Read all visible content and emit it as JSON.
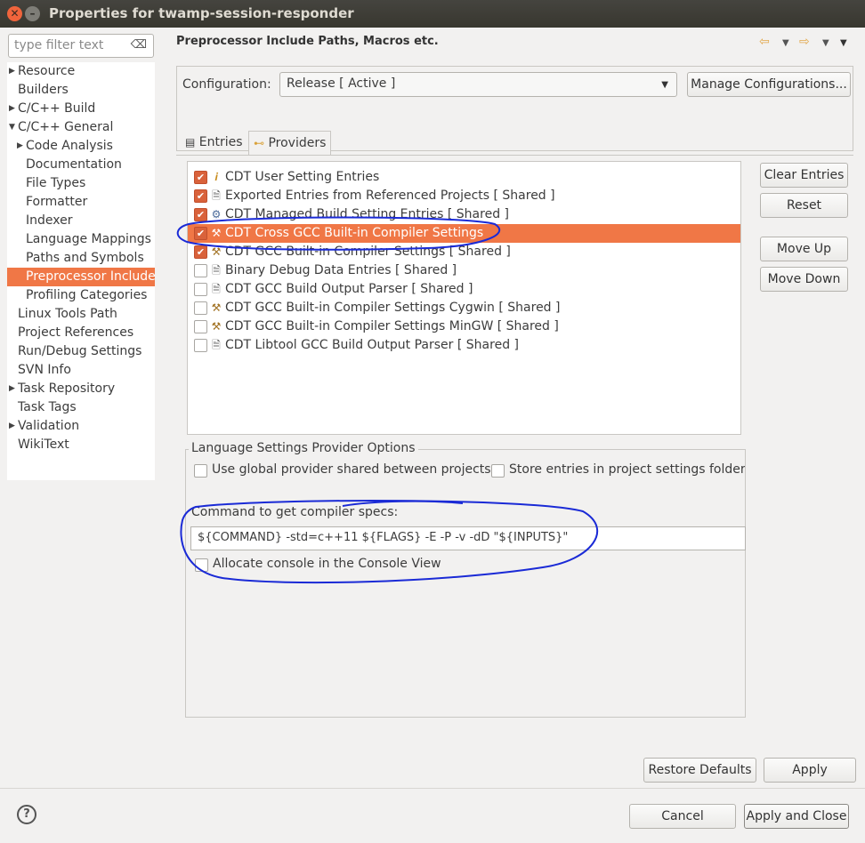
{
  "window": {
    "title": "Properties for twamp-session-responder"
  },
  "filter": {
    "placeholder": "type filter text"
  },
  "tree": [
    {
      "label": "Resource",
      "arrow": true,
      "indent": 0
    },
    {
      "label": "Builders",
      "arrow": false,
      "indent": 0
    },
    {
      "label": "C/C++ Build",
      "arrow": true,
      "indent": 0
    },
    {
      "label": "C/C++ General",
      "arrow": "open",
      "indent": 0
    },
    {
      "label": "Code Analysis",
      "arrow": true,
      "indent": 1
    },
    {
      "label": "Documentation",
      "arrow": false,
      "indent": 1
    },
    {
      "label": "File Types",
      "arrow": false,
      "indent": 1
    },
    {
      "label": "Formatter",
      "arrow": false,
      "indent": 1
    },
    {
      "label": "Indexer",
      "arrow": false,
      "indent": 1
    },
    {
      "label": "Language Mappings",
      "arrow": false,
      "indent": 1
    },
    {
      "label": "Paths and Symbols",
      "arrow": false,
      "indent": 1
    },
    {
      "label": "Preprocessor Include",
      "arrow": false,
      "indent": 1,
      "selected": true
    },
    {
      "label": "Profiling Categories",
      "arrow": false,
      "indent": 1
    },
    {
      "label": "Linux Tools Path",
      "arrow": false,
      "indent": 0
    },
    {
      "label": "Project References",
      "arrow": false,
      "indent": 0
    },
    {
      "label": "Run/Debug Settings",
      "arrow": false,
      "indent": 0
    },
    {
      "label": "SVN Info",
      "arrow": false,
      "indent": 0
    },
    {
      "label": "Task Repository",
      "arrow": true,
      "indent": 0
    },
    {
      "label": "Task Tags",
      "arrow": false,
      "indent": 0
    },
    {
      "label": "Validation",
      "arrow": true,
      "indent": 0
    },
    {
      "label": "WikiText",
      "arrow": false,
      "indent": 0
    }
  ],
  "page": {
    "title": "Preprocessor Include Paths, Macros etc."
  },
  "config": {
    "label": "Configuration:",
    "value": "Release  [ Active ]",
    "manage_label": "Manage Configurations..."
  },
  "tabs": {
    "entries": "Entries",
    "providers": "Providers"
  },
  "providers": [
    {
      "label": "CDT User Setting Entries",
      "checked": true,
      "icon": "user-setting-icon"
    },
    {
      "label": "Exported Entries from Referenced Projects  [ Shared ]",
      "checked": true,
      "icon": "exported-entries-icon"
    },
    {
      "label": "CDT Managed Build Setting Entries  [ Shared ]",
      "checked": true,
      "icon": "managed-build-icon"
    },
    {
      "label": "CDT Cross GCC Built-in Compiler Settings",
      "checked": true,
      "icon": "compiler-icon",
      "selected": true
    },
    {
      "label": "CDT GCC Built-in Compiler Settings  [ Shared ]",
      "checked": true,
      "icon": "compiler-icon"
    },
    {
      "label": "Binary Debug Data Entries  [ Shared ]",
      "checked": false,
      "icon": "document-icon"
    },
    {
      "label": "CDT GCC Build Output Parser  [ Shared ]",
      "checked": false,
      "icon": "document-icon"
    },
    {
      "label": "CDT GCC Built-in Compiler Settings Cygwin  [ Shared ]",
      "checked": false,
      "icon": "compiler-icon"
    },
    {
      "label": "CDT GCC Built-in Compiler Settings MinGW  [ Shared ]",
      "checked": false,
      "icon": "compiler-icon"
    },
    {
      "label": "CDT Libtool GCC Build Output Parser  [ Shared ]",
      "checked": false,
      "icon": "document-icon"
    }
  ],
  "side_buttons": {
    "clear": "Clear Entries",
    "reset": "Reset",
    "move_up": "Move Up",
    "move_down": "Move Down"
  },
  "options": {
    "title": "Language Settings Provider Options",
    "global_label": "Use global provider shared between projects",
    "store_label": "Store entries in project settings folder (",
    "command_label": "Command to get compiler specs:",
    "command_value": "${COMMAND} -std=c++11 ${FLAGS} -E -P -v -dD \"${INPUTS}\"",
    "console_label": "Allocate console in the Console View"
  },
  "buttons": {
    "restore_defaults": "Restore Defaults",
    "apply": "Apply",
    "cancel": "Cancel",
    "apply_close": "Apply and Close"
  },
  "colors": {
    "selection": "#f07746",
    "checkbox": "#d9623b",
    "annotation": "#1a2ad6"
  }
}
